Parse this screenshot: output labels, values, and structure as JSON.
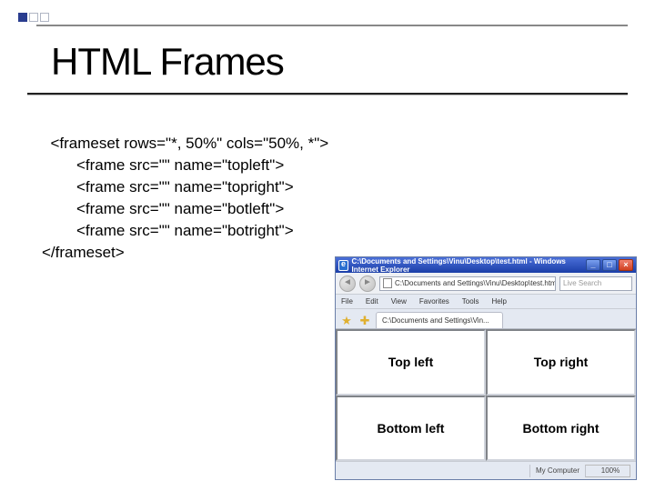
{
  "title": "HTML Frames",
  "code": {
    "l1": "<frameset rows=\"*, 50%\" cols=\"50%, *\">",
    "l2": "<frame src=\"\" name=\"topleft\">",
    "l3": "<frame src=\"\" name=\"topright\">",
    "l4": "<frame src=\"\" name=\"botleft\">",
    "l5": "<frame src=\"\" name=\"botright\">",
    "l6": "</frameset>"
  },
  "browser": {
    "window_title": "C:\\Documents and Settings\\Vinu\\Desktop\\test.html - Windows Internet Explorer",
    "address": "C:\\Documents and Settings\\Vinu\\Desktop\\test.html",
    "search_placeholder": "Live Search",
    "menu": {
      "file": "File",
      "edit": "Edit",
      "view": "View",
      "fav": "Favorites",
      "tools": "Tools",
      "help": "Help"
    },
    "tab": "C:\\Documents and Settings\\Vin...",
    "frames": {
      "topleft": "Top left",
      "topright": "Top right",
      "botleft": "Bottom left",
      "botright": "Bottom right"
    },
    "status": {
      "zone": "My Computer",
      "zoom": "100%"
    }
  }
}
